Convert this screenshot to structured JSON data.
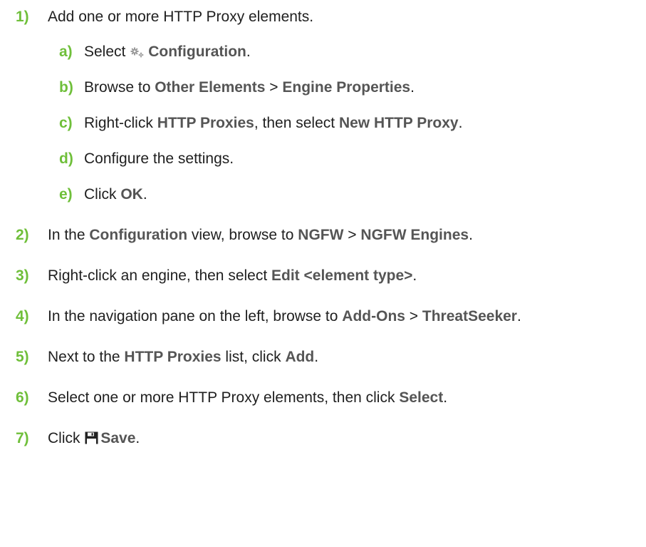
{
  "colors": {
    "step_number": "#6fbf3a",
    "ui_label": "#555555",
    "text": "#1f1f1f"
  },
  "icons": {
    "configuration": "gears-icon",
    "save": "floppy-disk-icon"
  },
  "step1": {
    "num": "1)",
    "text": "Add one or more HTTP Proxy elements."
  },
  "step1a": {
    "num": "a)",
    "pre": "Select",
    "ui1": "Configuration",
    "post": "."
  },
  "step1b": {
    "num": "b)",
    "pre": "Browse to",
    "ui1": "Other Elements",
    "sep": ">",
    "ui2": "Engine Properties",
    "post": "."
  },
  "step1c": {
    "num": "c)",
    "pre": "Right-click",
    "ui1": "HTTP Proxies",
    "mid": ", then select",
    "ui2": "New HTTP Proxy",
    "post": "."
  },
  "step1d": {
    "num": "d)",
    "text": "Configure the settings."
  },
  "step1e": {
    "num": "e)",
    "pre": "Click",
    "ui1": "OK",
    "post": "."
  },
  "step2": {
    "num": "2)",
    "pre": "In the",
    "ui1": "Configuration",
    "mid": "view, browse to",
    "ui2": "NGFW",
    "sep": ">",
    "ui3": "NGFW Engines",
    "post": "."
  },
  "step3": {
    "num": "3)",
    "pre": "Right-click an engine, then select",
    "ui1": "Edit <element type>",
    "post": "."
  },
  "step4": {
    "num": "4)",
    "pre": "In the navigation pane on the left, browse to",
    "ui1": "Add-Ons",
    "sep": ">",
    "ui2": "ThreatSeeker",
    "post": "."
  },
  "step5": {
    "num": "5)",
    "pre": "Next to the",
    "ui1": "HTTP Proxies",
    "mid": "list, click",
    "ui2": "Add",
    "post": "."
  },
  "step6": {
    "num": "6)",
    "pre": "Select one or more HTTP Proxy elements, then click",
    "ui1": "Select",
    "post": "."
  },
  "step7": {
    "num": "7)",
    "pre": "Click",
    "ui1": "Save",
    "post": "."
  }
}
